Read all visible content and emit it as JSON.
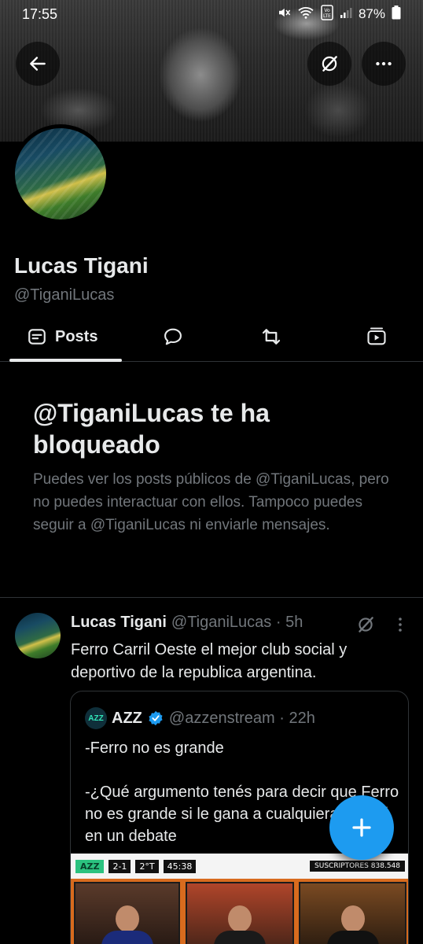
{
  "status_bar": {
    "time": "17:55",
    "battery": "87%",
    "network": "Vo) LTE1"
  },
  "profile": {
    "name": "Lucas Tigani",
    "handle": "@TiganiLucas"
  },
  "tabs": [
    {
      "label": "Posts",
      "icon": "posts-icon",
      "active": true
    },
    {
      "label": "",
      "icon": "replies-icon"
    },
    {
      "label": "",
      "icon": "reposts-icon"
    },
    {
      "label": "",
      "icon": "media-icon"
    }
  ],
  "blocked": {
    "title": "@TiganiLucas te ha bloqueado",
    "body": "Puedes ver los posts públicos de @TiganiLucas, pero no puedes interactuar con ellos. Tampoco puedes seguir a @TiganiLucas ni enviarle mensajes."
  },
  "post": {
    "name": "Lucas Tigani",
    "meta": "@TiganiLucas · 5h",
    "text": "Ferro Carril Oeste el mejor club social y deportivo de la republica argentina.",
    "quote": {
      "logo_text": "AZZ",
      "name": "AZZ",
      "meta": "@azzenstream · 22h",
      "text": "-Ferro no es grande\n\n-¿Qué argumento tenés para decir que Ferro no es grande si le gana a cualquiera de acá en un debate",
      "media": {
        "score": "2-1",
        "period": "2°T",
        "clock": "45:38",
        "subs_label": "SUSCRIPTORES",
        "subs_count": "838.548"
      }
    }
  },
  "colors": {
    "accent": "#1d9bf0",
    "background": "#000000",
    "text": "#e7e9ea",
    "muted": "#71767b",
    "border": "#2f3336"
  }
}
